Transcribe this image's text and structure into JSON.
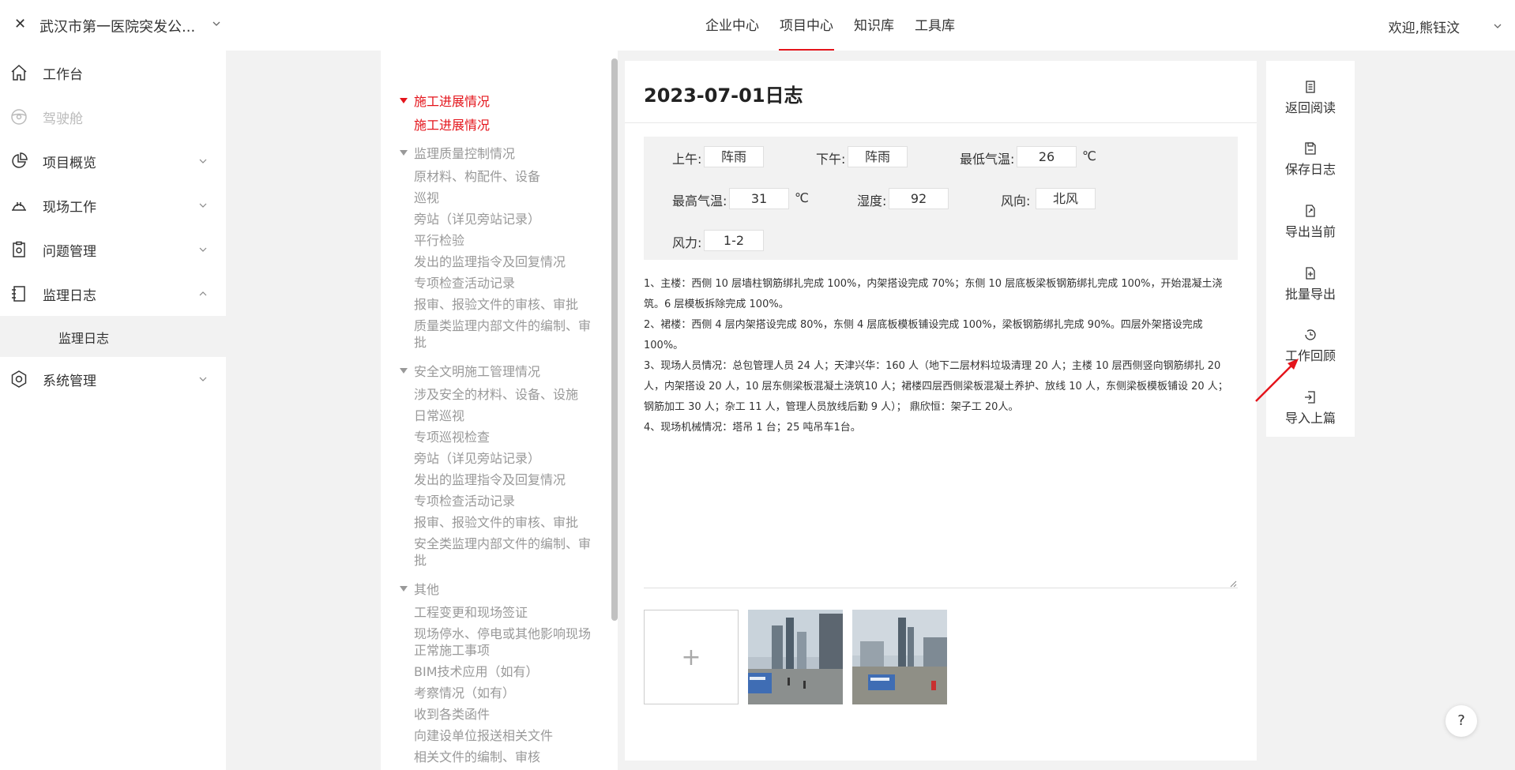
{
  "header": {
    "project_name": "武汉市第一医院突发公...",
    "nav": [
      "企业中心",
      "项目中心",
      "知识库",
      "工具库"
    ],
    "active_nav": "项目中心",
    "welcome": "欢迎,熊钰汶"
  },
  "sidebar": {
    "items": [
      {
        "label": "工作台",
        "icon": "home-icon"
      },
      {
        "label": "驾驶舱",
        "icon": "steering-wheel-icon",
        "disabled": true
      },
      {
        "label": "项目概览",
        "icon": "pie-chart-icon"
      },
      {
        "label": "现场工作",
        "icon": "helmet-icon"
      },
      {
        "label": "问题管理",
        "icon": "clipboard-icon"
      },
      {
        "label": "监理日志",
        "icon": "book-icon"
      },
      {
        "label": "系统管理",
        "icon": "settings-icon"
      }
    ],
    "sub_item": "监理日志"
  },
  "toc": {
    "sections": [
      {
        "title": "施工进展情况",
        "items": [
          "施工进展情况"
        ]
      },
      {
        "title": "监理质量控制情况",
        "items": [
          "原材料、构配件、设备",
          "巡视",
          "旁站（详见旁站记录）",
          "平行检验",
          "发出的监理指令及回复情况",
          "专项检查活动记录",
          "报审、报验文件的审核、审批",
          "质量类监理内部文件的编制、审批"
        ]
      },
      {
        "title": "安全文明施工管理情况",
        "items": [
          "涉及安全的材料、设备、设施",
          "日常巡视",
          "专项巡视检查",
          "旁站（详见旁站记录）",
          "发出的监理指令及回复情况",
          "专项检查活动记录",
          "报审、报验文件的审核、审批",
          "安全类监理内部文件的编制、审批"
        ]
      },
      {
        "title": "其他",
        "items": [
          "工程变更和现场签证",
          "现场停水、停电或其他影响现场正常施工事项",
          "BIM技术应用（如有）",
          "考察情况（如有）",
          "收到各类函件",
          "向建设单位报送相关文件",
          "相关文件的编制、审核"
        ]
      }
    ]
  },
  "log": {
    "title": "2023-07-01日志",
    "weather": {
      "am_label": "上午:",
      "am": "阵雨",
      "pm_label": "下午:",
      "pm": "阵雨",
      "min_temp_label": "最低气温:",
      "min_temp": "26",
      "max_temp_label": "最高气温:",
      "max_temp": "31",
      "humidity_label": "湿度:",
      "humidity": "92",
      "wind_dir_label": "风向:",
      "wind_dir": "北风",
      "wind_force_label": "风力:",
      "wind_force": "1-2",
      "unit": "℃"
    },
    "content": [
      "1、主楼：西侧 10 层墙柱钢筋绑扎完成 100%，内架搭设完成 70%；东侧 10 层底板梁板钢筋绑扎完成 100%，开始混凝土浇筑。6 层模板拆除完成 100%。",
      "2、裙楼：西侧 4 层内架搭设完成 80%，东侧 4 层底板模板铺设完成 100%，梁板钢筋绑扎完成 90%。四层外架搭设完成 100%。",
      "3、现场人员情况：总包管理人员 24 人；天津兴华：160 人（地下二层材料垃圾清理 20 人；主楼 10 层西侧竖向钢筋绑扎 20 人，内架搭设 20 人，10 层东侧梁板混凝土浇筑10 人；裙楼四层西侧梁板混凝土养护、放线 10 人，东侧梁板模板铺设 20 人；钢筋加工 30 人；杂工 11 人，管理人员放线后勤 9 人）； 鼎欣恒：架子工 20人。",
      "4、现场机械情况：塔吊 1 台；25 吨吊车1台。"
    ],
    "add_symbol": "+"
  },
  "actions": [
    {
      "label": "返回阅读",
      "icon": "document-icon"
    },
    {
      "label": "保存日志",
      "icon": "save-icon"
    },
    {
      "label": "导出当前",
      "icon": "export-icon"
    },
    {
      "label": "批量导出",
      "icon": "batch-export-icon"
    },
    {
      "label": "工作回顾",
      "icon": "history-icon"
    },
    {
      "label": "导入上篇",
      "icon": "import-icon"
    }
  ],
  "help": "?",
  "colors": {
    "accent": "#e4141b",
    "bg": "#f2f2f2"
  }
}
